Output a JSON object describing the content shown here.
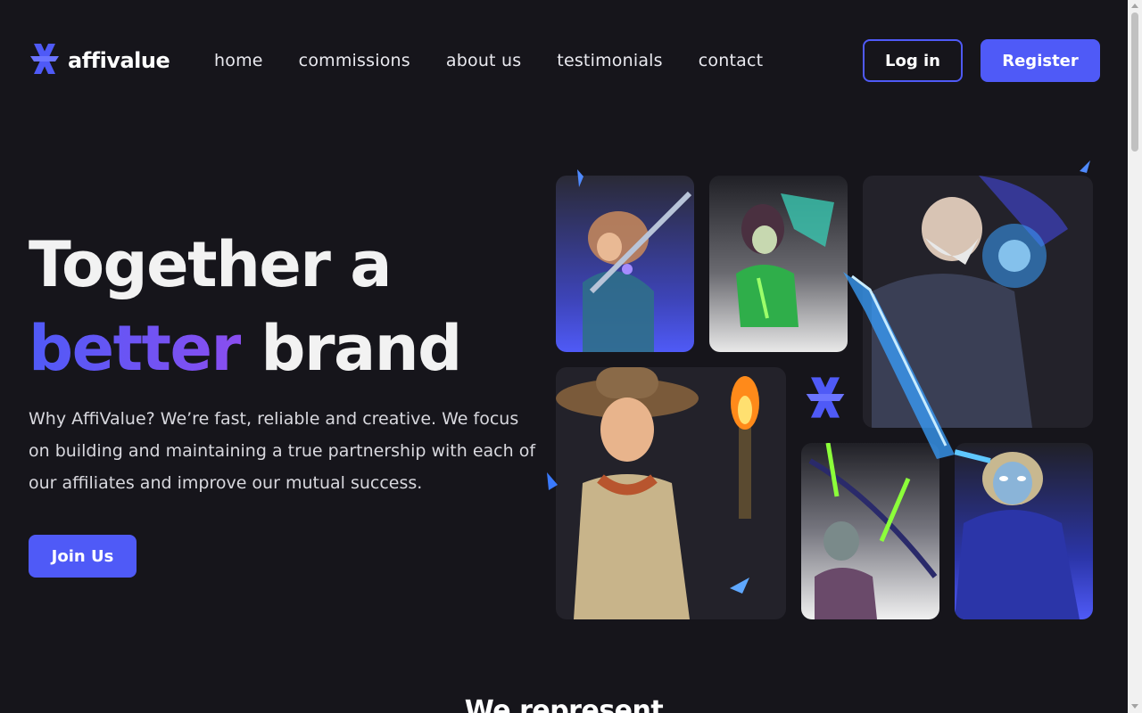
{
  "brand": {
    "name": "affivalue",
    "logo_icon": "affivalue-star-logo-icon",
    "accent_color": "#4f5af7",
    "accent_gradient_end": "#8a4ef0",
    "background_color": "#16151b"
  },
  "nav": {
    "items": [
      {
        "label": "home"
      },
      {
        "label": "commissions"
      },
      {
        "label": "about us"
      },
      {
        "label": "testimonials"
      },
      {
        "label": "contact"
      }
    ]
  },
  "auth": {
    "login_label": "Log in",
    "register_label": "Register"
  },
  "hero": {
    "title_line1": "Together a",
    "title_accent": "better",
    "title_line2_rest": "brand",
    "description": "Why AffiValue? We’re fast, reliable and creative. We focus on building and maintaining a true partnership with each of our affiliates and improve our mutual success.",
    "cta_label": "Join Us"
  },
  "gallery": {
    "cards": [
      {
        "icon": "archer-heroine-illustration"
      },
      {
        "icon": "elf-ranger-illustration"
      },
      {
        "icon": "ice-wizard-illustration"
      },
      {
        "icon": "explorer-with-torch-illustration"
      },
      {
        "icon": "goblin-archer-illustration"
      },
      {
        "icon": "ghost-sorceress-illustration"
      }
    ],
    "center_icon": "affivalue-star-logo-icon"
  },
  "next_section": {
    "heading": "We represent"
  }
}
